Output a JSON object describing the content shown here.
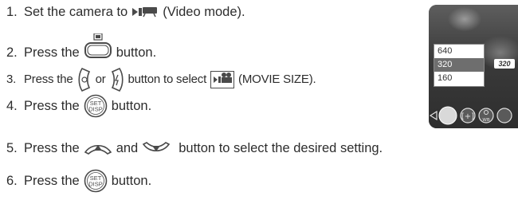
{
  "steps": [
    {
      "num": "1.",
      "before": "Set the camera to",
      "after": "(Video mode)."
    },
    {
      "num": "2.",
      "before": "Press the",
      "after": "button."
    },
    {
      "num": "3.",
      "before": "Press the",
      "middle": "or",
      "after1": "button to select",
      "after2": "(MOVIE SIZE)."
    },
    {
      "num": "4.",
      "before": "Press the",
      "after": "button."
    },
    {
      "num": "5.",
      "before": "Press the",
      "middle": "and",
      "after": "button to select the desired setting."
    },
    {
      "num": "6.",
      "before": "Press the",
      "after": "button."
    }
  ],
  "buttons": {
    "set_disp_top": "SET",
    "set_disp_bottom": "DISP",
    "wb": "WB"
  },
  "lcd": {
    "options": [
      "640",
      "320",
      "160"
    ],
    "selected": "320",
    "badge": "320"
  },
  "colors": {
    "text": "#2d2d2d",
    "icon": "#4a4a4a",
    "lcd_bg": "#4a4a4a",
    "highlight": "#6e6e6e"
  },
  "icons": [
    "video-mode-icon",
    "menu-button-icon",
    "left-arrow-button-icon",
    "right-flash-button-icon",
    "movie-size-icon",
    "set-disp-button-icon",
    "up-button-icon",
    "down-button-icon"
  ]
}
